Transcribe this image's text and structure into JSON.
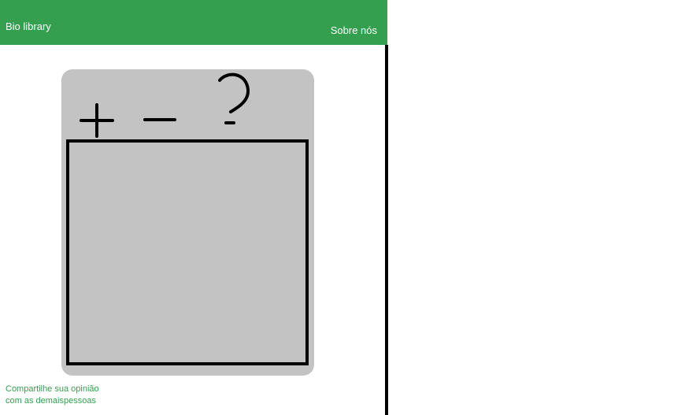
{
  "header": {
    "brand": "Bio library",
    "about_link": "Sobre nós"
  },
  "toolbar": {
    "tools": [
      {
        "name": "zoom-in",
        "icon": "plus-icon"
      },
      {
        "name": "zoom-out",
        "icon": "minus-icon"
      },
      {
        "name": "help",
        "icon": "question-mark-icon"
      }
    ]
  },
  "footer": {
    "line1": "Compartilhe sua opinião",
    "line2": "com as demaispessoas"
  },
  "colors": {
    "header": "#34a04f",
    "panel": "#c3c3c3",
    "footer_text": "#34a04f"
  }
}
